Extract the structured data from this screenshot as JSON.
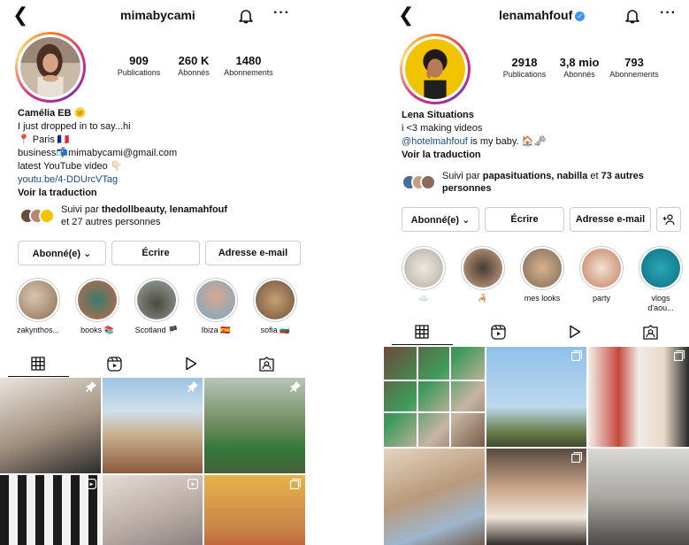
{
  "profiles": [
    {
      "username": "mimabycami",
      "verified": false,
      "stats": [
        {
          "value": "909",
          "label": "Publications"
        },
        {
          "value": "260 K",
          "label": "Abonnés"
        },
        {
          "value": "1480",
          "label": "Abonnements"
        }
      ],
      "bio": {
        "name": "Camélia EB 🌞",
        "lines": [
          "I just dropped in to say...hi",
          "📍 Paris 🇫🇷",
          "business📬mimabycami@gmail.com",
          "latest YouTube video 👇🏻"
        ],
        "link": "youtu.be/4-DDUrcVTag",
        "translate": "Voir la traduction"
      },
      "followed_by": {
        "prefix": "Suivi par ",
        "names": "thedollbeauty, lenamahfouf",
        "middle": "",
        "suffix": "et 27 autres personnes"
      },
      "buttons": [
        "Abonné(e) ⌄",
        "Écrire",
        "Adresse e-mail"
      ],
      "highlights": [
        "zakynthos...",
        "books 📚",
        "Scotland 🏴",
        "Ibiza 🇪🇸",
        "sofia 🇧🇬"
      ]
    },
    {
      "username": "lenamahfouf",
      "verified": true,
      "stats": [
        {
          "value": "2918",
          "label": "Publications"
        },
        {
          "value": "3,8 mio",
          "label": "Abonnés"
        },
        {
          "value": "793",
          "label": "Abonnements"
        }
      ],
      "bio": {
        "name": "Lena Situations",
        "lines": [
          "i <3 making videos"
        ],
        "mention": "@hotelmahfouf",
        "mention_rest": " is my baby. 🏠🗝",
        "translate": "Voir la traduction"
      },
      "followed_by": {
        "prefix": "Suivi par ",
        "names": "papasituations, nabilla",
        "middle": " et ",
        "suffix": "73 autres personnes"
      },
      "buttons": [
        "Abonné(e) ⌄",
        "Écrire",
        "Adresse e-mail"
      ],
      "highlights": [
        "☁️",
        "🦂",
        "mes looks",
        "party",
        "vlogs d'aou..."
      ]
    }
  ],
  "colors": {
    "link": "#1a4a8a",
    "verified": "#3897f0",
    "story_ring": "#dd2a7b",
    "border": "#cccccc"
  },
  "icons": [
    "back-icon",
    "bell-icon",
    "more-icon",
    "grid-icon",
    "reels-icon",
    "play-icon",
    "tagged-icon",
    "pin-icon",
    "reel-badge-icon",
    "multi-post-icon",
    "add-person-icon"
  ]
}
